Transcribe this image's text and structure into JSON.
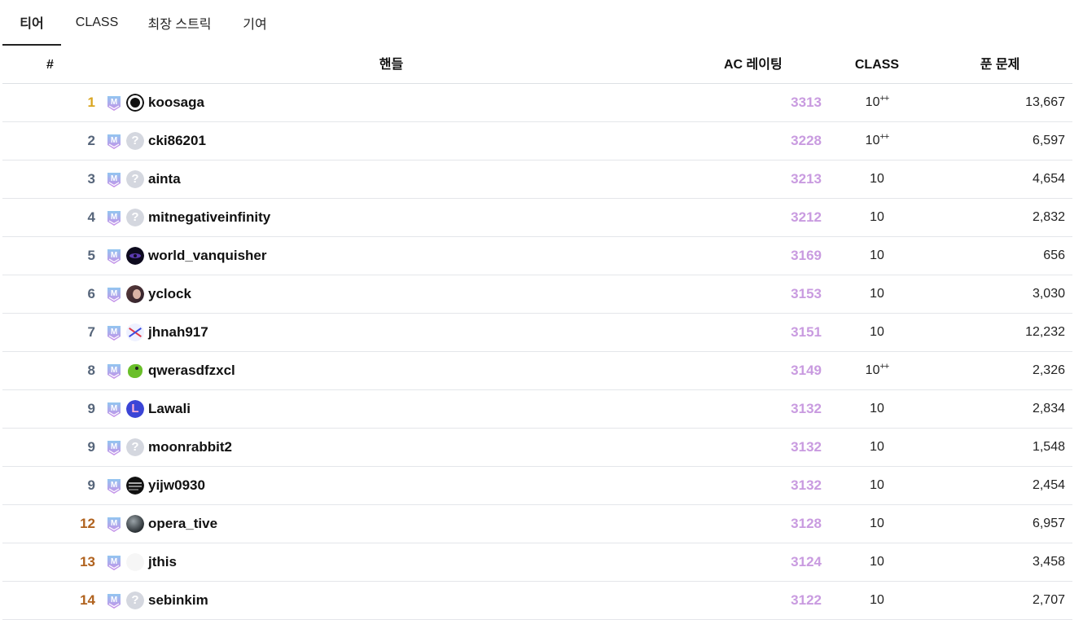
{
  "tabs": [
    "티어",
    "CLASS",
    "최장 스트릭",
    "기여"
  ],
  "active_tab": 0,
  "columns": {
    "rank": "#",
    "handle": "핸들",
    "rating": "AC 레이팅",
    "class": "CLASS",
    "solved": "푼 문제"
  },
  "tier_badge_label": "M",
  "colors": {
    "rating": "#c99be0",
    "rank_gold": "#d9a520",
    "rank_default": "#56657a",
    "rank_bronze": "#b0621e",
    "tier_badge_top": "#93c6f0",
    "tier_badge_bottom": "#c98ee8"
  },
  "rows": [
    {
      "rank": "1",
      "rank_color": "#d9a520",
      "handle": "koosaga",
      "avatar": "k-logo",
      "rating": "3313",
      "class": "10",
      "class_sup": "++",
      "solved": "13,667"
    },
    {
      "rank": "2",
      "rank_color": "#56657a",
      "handle": "cki86201",
      "avatar": "question",
      "avatar_glyph": "?",
      "rating": "3228",
      "class": "10",
      "class_sup": "++",
      "solved": "6,597"
    },
    {
      "rank": "3",
      "rank_color": "#56657a",
      "handle": "ainta",
      "avatar": "question",
      "avatar_glyph": "?",
      "rating": "3213",
      "class": "10",
      "class_sup": "",
      "solved": "4,654"
    },
    {
      "rank": "4",
      "rank_color": "#56657a",
      "handle": "mitnegativeinfinity",
      "avatar": "question",
      "avatar_glyph": "?",
      "rating": "3212",
      "class": "10",
      "class_sup": "",
      "solved": "2,832"
    },
    {
      "rank": "5",
      "rank_color": "#56657a",
      "handle": "world_vanquisher",
      "avatar": "dark-eye",
      "rating": "3169",
      "class": "10",
      "class_sup": "",
      "solved": "656"
    },
    {
      "rank": "6",
      "rank_color": "#56657a",
      "handle": "yclock",
      "avatar": "anime-portrait",
      "rating": "3153",
      "class": "10",
      "class_sup": "",
      "solved": "3,030"
    },
    {
      "rank": "7",
      "rank_color": "#56657a",
      "handle": "jhnah917",
      "avatar": "crossed-character",
      "rating": "3151",
      "class": "10",
      "class_sup": "",
      "solved": "12,232"
    },
    {
      "rank": "8",
      "rank_color": "#56657a",
      "handle": "qwerasdfzxcl",
      "avatar": "green-creature",
      "rating": "3149",
      "class": "10",
      "class_sup": "++",
      "solved": "2,326"
    },
    {
      "rank": "9",
      "rank_color": "#56657a",
      "handle": "Lawali",
      "avatar": "letter-l",
      "avatar_glyph": "L",
      "rating": "3132",
      "class": "10",
      "class_sup": "",
      "solved": "2,834"
    },
    {
      "rank": "9",
      "rank_color": "#56657a",
      "handle": "moonrabbit2",
      "avatar": "question",
      "avatar_glyph": "?",
      "rating": "3132",
      "class": "10",
      "class_sup": "",
      "solved": "1,548"
    },
    {
      "rank": "9",
      "rank_color": "#56657a",
      "handle": "yijw0930",
      "avatar": "dark-text",
      "rating": "3132",
      "class": "10",
      "class_sup": "",
      "solved": "2,454"
    },
    {
      "rank": "12",
      "rank_color": "#b0621e",
      "handle": "opera_tive",
      "avatar": "dark-sphere",
      "rating": "3128",
      "class": "10",
      "class_sup": "",
      "solved": "6,957"
    },
    {
      "rank": "13",
      "rank_color": "#b0621e",
      "handle": "jthis",
      "avatar": "blank",
      "rating": "3124",
      "class": "10",
      "class_sup": "",
      "solved": "3,458"
    },
    {
      "rank": "14",
      "rank_color": "#b0621e",
      "handle": "sebinkim",
      "avatar": "question",
      "avatar_glyph": "?",
      "rating": "3122",
      "class": "10",
      "class_sup": "",
      "solved": "2,707"
    }
  ]
}
